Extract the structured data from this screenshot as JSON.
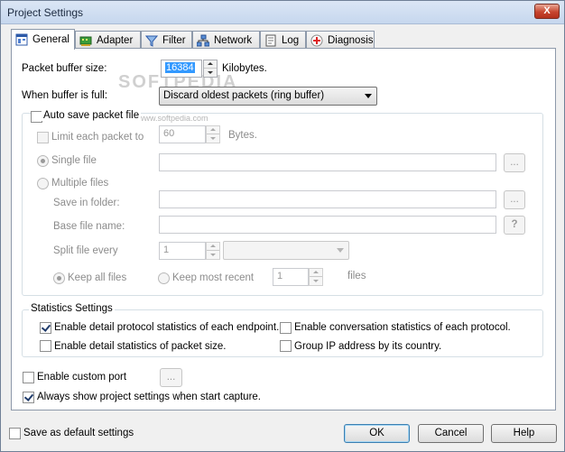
{
  "window": {
    "title": "Project Settings",
    "close_glyph": "X"
  },
  "tabs": [
    {
      "label": "General",
      "icon": "general-icon"
    },
    {
      "label": "Adapter",
      "icon": "adapter-icon"
    },
    {
      "label": "Filter",
      "icon": "filter-icon"
    },
    {
      "label": "Network",
      "icon": "network-icon"
    },
    {
      "label": "Log",
      "icon": "log-icon"
    },
    {
      "label": "Diagnosis",
      "icon": "diagnosis-icon"
    }
  ],
  "general": {
    "buffer_size_label": "Packet buffer size:",
    "buffer_size_value": "16384",
    "buffer_size_unit": "Kilobytes.",
    "buffer_full_label": "When buffer is full:",
    "buffer_full_value": "Discard oldest packets (ring buffer)",
    "auto_save": {
      "label": "Auto save packet file",
      "limit_label": "Limit each packet to",
      "limit_value": "60",
      "limit_unit": "Bytes.",
      "single_file_label": "Single file",
      "single_file_value": "",
      "browse1": "...",
      "multiple_files_label": "Multiple files",
      "save_folder_label": "Save in folder:",
      "save_folder_value": "",
      "browse2": "...",
      "base_name_label": "Base file name:",
      "base_name_value": "",
      "help_btn": "?",
      "split_label": "Split file every",
      "split_value": "1",
      "split_unit": "",
      "keep_all_label": "Keep all files",
      "keep_recent_label": "Keep most recent",
      "keep_recent_value": "1",
      "files_label": "files"
    },
    "stats": {
      "title": "Statistics Settings",
      "endpoint": "Enable detail protocol statistics of each endpoint.",
      "conversation": "Enable conversation statistics of each protocol.",
      "packet_size": "Enable detail statistics of packet size.",
      "group_ip": "Group IP address by its country."
    },
    "custom_port_label": "Enable custom port",
    "custom_port_btn": "...",
    "always_show_label": "Always show project settings when start capture."
  },
  "footer": {
    "save_default_label": "Save as default settings",
    "ok": "OK",
    "cancel": "Cancel",
    "help": "Help"
  },
  "watermark": {
    "main": "SOFTPEDIA",
    "url": "www.softpedia.com"
  }
}
